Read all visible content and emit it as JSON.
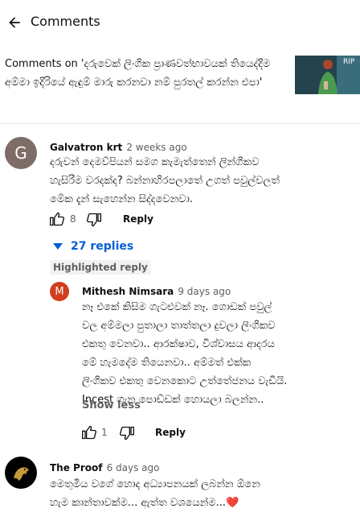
{
  "header": {
    "title": "Comments"
  },
  "video": {
    "title": "Comments on 'දරුවෙක් ලිංගික ප්‍රාණවත්භාවයක් තියෙද්දීම අම්මා ඉදිරියේ ඇඳුම් මාරු කරනවා නම් පුරතල් කරන්න එපා'",
    "thumbnail_text": "RIP"
  },
  "comments": [
    {
      "author": "Galvatron krt",
      "age": "2 weeks ago",
      "avatar_letter": "G",
      "avatar_color": "#7e6c66",
      "text_lines": [
        "දරුවන් දෙමව්පියන් සමග කැමැත්තෙන් ලින්ගිකව",
        "හැසිරීම වරදක්ද? බන්නාහිරපලාතේ උගත් පවුල්වලත්",
        "මේක දැන් සැහෙන්න සිද්දවෙනවා."
      ],
      "likes": "8",
      "reply_label": "Reply",
      "replies_toggle": "27 replies"
    }
  ],
  "highlighted": {
    "badge": "Highlighted reply",
    "author": "Mithesh Nimsara",
    "age": "9 days ago",
    "avatar_letter": "M",
    "avatar_color": "#d23f1d",
    "text_lines": [
      "නෑ එකේ කිසිම ගැටළුවක් නෑ. ගොඩක් පවුල්",
      "වල අම්මලා පුතාලා තාත්තලා දුවලා ලිංගිකව",
      "එකතු වෙනවා.. ආරක්ෂාව, විශ්වාසය ආදරය",
      "මේ හැමදේම තියෙනවා.. අම්මත් එක්ක",
      "ලිංගිකව එකතු වෙනකොට උත්තේජනය වැඩියි.",
      "Incest ගැන පොඩ්ඩක් හොයලා බලන්න.."
    ],
    "show_less": "Show less",
    "likes": "1",
    "reply_label": "Reply"
  },
  "third": {
    "author": "The Proof",
    "age": "6 days ago",
    "text_lines": [
      "මෙතුමිය වගේ හොද අධ්‍යාපනයක් ලබන්න ඕනෙ",
      "හැම කාන්තාවක්ම... ඇත්ත වශයෙන්ම..."
    ],
    "heart": "❤️"
  },
  "colors": {
    "link_blue": "#065fd4",
    "secondary": "#606060"
  }
}
